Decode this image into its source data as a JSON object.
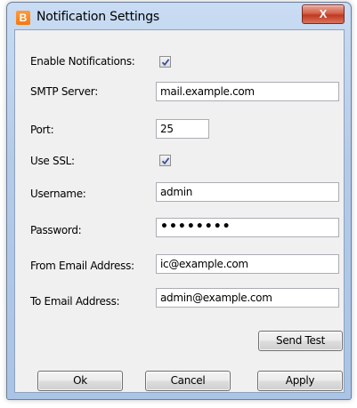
{
  "window": {
    "title": "Notification Settings",
    "app_icon_letter": "B",
    "close_glyph": "X"
  },
  "form": {
    "enable_notifications": {
      "label": "Enable Notifications:",
      "checked": true
    },
    "smtp_server": {
      "label": "SMTP Server:",
      "value": "mail.example.com"
    },
    "port": {
      "label": "Port:",
      "value": "25"
    },
    "use_ssl": {
      "label": "Use SSL:",
      "checked": true
    },
    "username": {
      "label": "Username:",
      "value": "admin"
    },
    "password": {
      "label": "Password:",
      "value": "••••••••"
    },
    "from_email": {
      "label": "From Email Address:",
      "value": "ic@example.com"
    },
    "to_email": {
      "label": "To Email Address:",
      "value": "admin@example.com"
    }
  },
  "buttons": {
    "send_test": "Send Test",
    "ok": "Ok",
    "cancel": "Cancel",
    "apply": "Apply"
  },
  "colors": {
    "frame": "#b4cbe8",
    "client_bg": "#f0f0f0",
    "close": "#c0391f",
    "app_icon": "#f07a10"
  }
}
